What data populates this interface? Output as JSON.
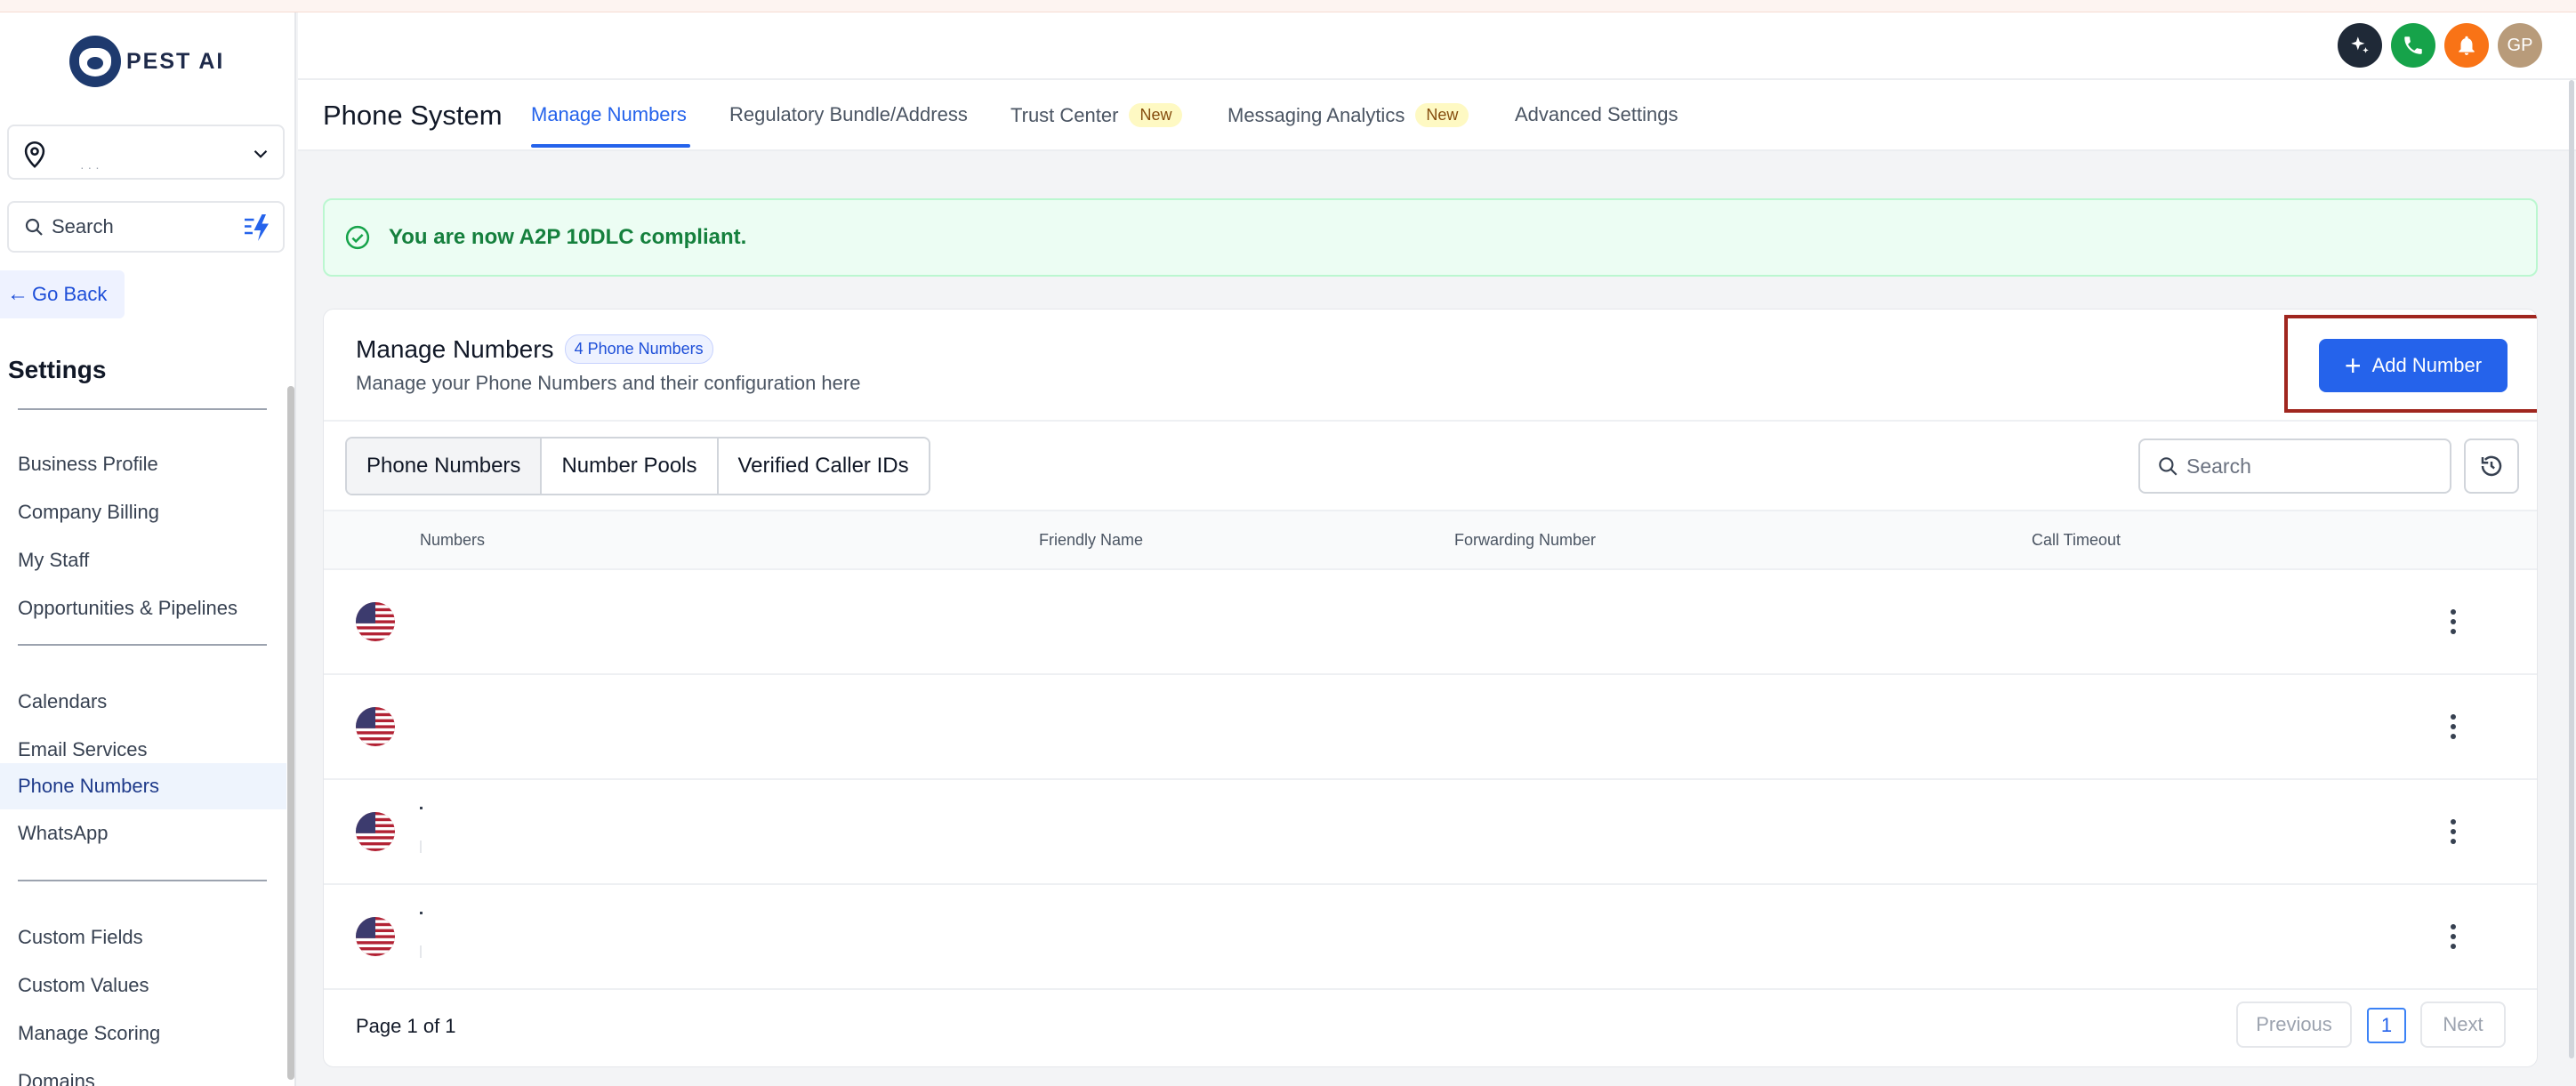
{
  "app": {
    "brand": "PEST AI"
  },
  "sidebar": {
    "search_label": "Search",
    "go_back": "Go Back",
    "section_title": "Settings",
    "groups": [
      [
        "Business Profile",
        "Company Billing",
        "My Staff",
        "Opportunities & Pipelines"
      ],
      [
        "Calendars",
        "Email Services",
        "Phone Numbers",
        "WhatsApp"
      ],
      [
        "Custom Fields",
        "Custom Values",
        "Manage Scoring",
        "Domains"
      ]
    ],
    "active_item": "Phone Numbers"
  },
  "header": {
    "avatar_initials": "GP",
    "colors": {
      "ai": "#1f2937",
      "phone": "#16a34a",
      "bell": "#f97316",
      "avatar": "#b89b7a"
    }
  },
  "subheader": {
    "title": "Phone System",
    "tabs": [
      {
        "label": "Manage Numbers",
        "active": true
      },
      {
        "label": "Regulatory Bundle/Address"
      },
      {
        "label": "Trust Center",
        "badge": "New"
      },
      {
        "label": "Messaging Analytics",
        "badge": "New"
      },
      {
        "label": "Advanced Settings"
      }
    ]
  },
  "alert": {
    "message": "You are now A2P 10DLC compliant."
  },
  "card": {
    "title": "Manage Numbers",
    "count_badge": "4 Phone Numbers",
    "subtitle": "Manage your Phone Numbers and their configuration here",
    "add_button": "Add Number",
    "segments": [
      "Phone Numbers",
      "Number Pools",
      "Verified Caller IDs"
    ],
    "active_segment": "Phone Numbers",
    "search_placeholder": "Search",
    "columns": [
      "Numbers",
      "Friendly Name",
      "Forwarding Number",
      "Call Timeout"
    ],
    "rows": [
      {
        "country": "US"
      },
      {
        "country": "US"
      },
      {
        "country": "US"
      },
      {
        "country": "US"
      }
    ],
    "pagination": {
      "text": "Page 1 of 1",
      "previous": "Previous",
      "current": "1",
      "next": "Next"
    }
  },
  "accent_color": "#2563eb"
}
